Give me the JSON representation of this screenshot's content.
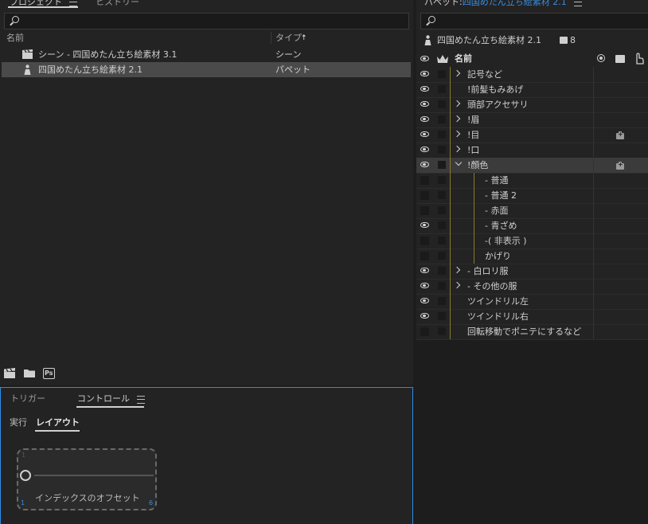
{
  "project_panel": {
    "tabs": [
      {
        "label": "プロジェクト"
      },
      {
        "label": "ヒストリー"
      }
    ],
    "columns": {
      "name": "名前",
      "type": "タイプ"
    },
    "items": [
      {
        "name": "シーン - 四国めたん立ち絵素材 3.1",
        "type": "シーン",
        "icon": "scene-clapper-icon"
      },
      {
        "name": "四国めたん立ち絵素材 2.1",
        "type": "パペット",
        "icon": "puppet-figure-icon"
      }
    ],
    "footer_icons": [
      "new-scene-icon",
      "folder-icon",
      "photoshop-icon"
    ],
    "ps_label": "Ps"
  },
  "control_panel": {
    "tabs": [
      {
        "label": "トリガー"
      },
      {
        "label": "コントロール"
      }
    ],
    "subtabs": [
      {
        "label": "実行"
      },
      {
        "label": "レイアウト"
      }
    ],
    "slider": {
      "label": "インデックスのオフセット",
      "min": "1",
      "max": "6",
      "value": 1,
      "top_hint": "1"
    }
  },
  "puppet_panel": {
    "title_prefix": "パペット:",
    "title_name": "四国めたん立ち絵素材 2.1",
    "puppet_name": "四国めたん立ち絵素材 2.1",
    "tag_count": "8",
    "column_name": "名前",
    "accent": "#3a8de0",
    "rows": [
      {
        "label": "記号など",
        "expander": "right",
        "visible": true,
        "indent": 0
      },
      {
        "label": "!前髪もみあげ",
        "expander": "none",
        "visible": true,
        "indent": 0
      },
      {
        "label": "頭部アクセサリ",
        "expander": "right",
        "visible": true,
        "indent": 0
      },
      {
        "label": "!眉",
        "expander": "right",
        "visible": true,
        "indent": 0
      },
      {
        "label": "!目",
        "expander": "right",
        "visible": true,
        "indent": 0,
        "tag": true
      },
      {
        "label": "!口",
        "expander": "right",
        "visible": true,
        "indent": 0
      },
      {
        "label": "!顔色",
        "expander": "down",
        "visible": true,
        "indent": 0,
        "tag": true,
        "selected": true
      },
      {
        "label": "- 普通",
        "expander": "none",
        "visible": false,
        "indent": 1
      },
      {
        "label": "- 普通 2",
        "expander": "none",
        "visible": false,
        "indent": 1
      },
      {
        "label": "- 赤面",
        "expander": "none",
        "visible": false,
        "indent": 1
      },
      {
        "label": "- 青ざめ",
        "expander": "none",
        "visible": true,
        "indent": 1
      },
      {
        "label": "-( 非表示 )",
        "expander": "none",
        "visible": false,
        "indent": 1
      },
      {
        "label": "かげり",
        "expander": "none",
        "visible": false,
        "indent": 1
      },
      {
        "label": "- 白ロリ服",
        "expander": "right",
        "visible": true,
        "indent": 0
      },
      {
        "label": "- その他の服",
        "expander": "right",
        "visible": true,
        "indent": 0
      },
      {
        "label": "ツインドリル左",
        "expander": "none",
        "visible": true,
        "indent": 0
      },
      {
        "label": "ツインドリル右",
        "expander": "none",
        "visible": true,
        "indent": 0
      },
      {
        "label": "回転移動でポニテにするなど",
        "expander": "none",
        "visible": false,
        "indent": 0
      }
    ]
  }
}
